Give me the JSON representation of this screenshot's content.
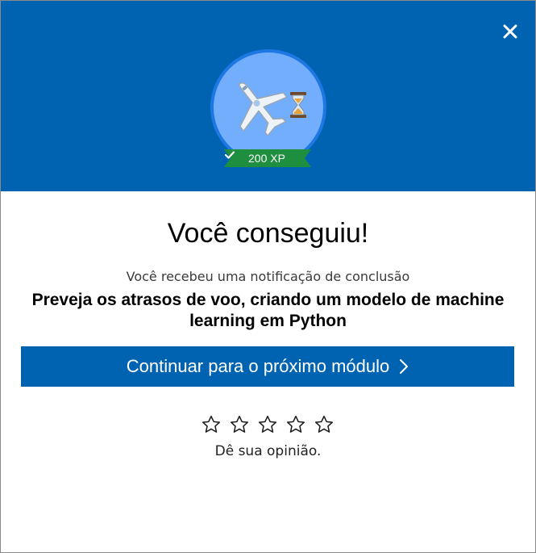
{
  "header": {
    "background_color": "#0063b1",
    "close_icon": "close-icon",
    "badge": {
      "icon": "airplane-icon",
      "secondary_icon": "hourglass-icon",
      "xp_label": "200 XP",
      "xp_ribbon_color": "#1e8f3e"
    }
  },
  "content": {
    "title": "Você conseguiu!",
    "subtitle": "Você recebeu uma notificação de conclusão",
    "module_name": "Preveja os atrasos de voo, criando um modelo de machine learning em Python"
  },
  "actions": {
    "continue_label": "Continuar para o próximo módulo",
    "continue_icon": "chevron-right-icon",
    "accent_color": "#0063b1"
  },
  "feedback": {
    "stars": 5,
    "star_icon": "star-outline-icon",
    "label": "Dê sua opinião."
  }
}
